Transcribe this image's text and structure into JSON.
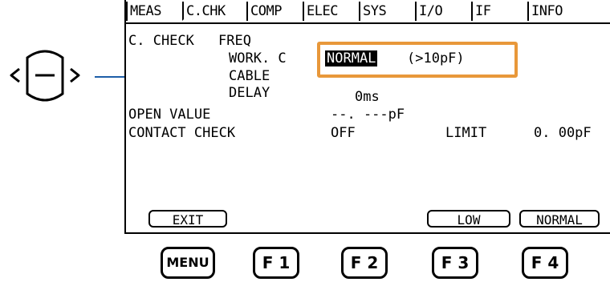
{
  "tabs": [
    {
      "label": "MEAS",
      "active": false
    },
    {
      "label": "C.CHK",
      "active": true
    },
    {
      "label": "COMP",
      "active": false
    },
    {
      "label": "ELEC",
      "active": false
    },
    {
      "label": "SYS",
      "active": false
    },
    {
      "label": "I/O",
      "active": false
    },
    {
      "label": "IF",
      "active": false
    },
    {
      "label": "INFO",
      "active": false
    }
  ],
  "settings": {
    "cchk_label": "C. CHECK",
    "freq_label": "FREQ",
    "freq_value": "",
    "work_c_label": "WORK. C",
    "work_c_value": "NORMAL",
    "work_c_suffix": "(>10pF)",
    "cable_label": "CABLE",
    "cable_value": "",
    "delay_label": "DELAY",
    "delay_value": "0ms",
    "open_value_label": "OPEN VALUE",
    "open_value": "--. ---pF",
    "contact_check_label": "CONTACT CHECK",
    "contact_check_value": "OFF",
    "limit_label": "LIMIT",
    "limit_value": "0. 00pF"
  },
  "function_keys": [
    "EXIT",
    "LOW",
    "NORMAL"
  ],
  "hardware_buttons": [
    "MENU",
    "F 1",
    "F 2",
    "F 3",
    "F 4"
  ],
  "colors": {
    "highlight": "#e8983a",
    "leader": "#1d5ea8"
  },
  "icons": {
    "dpad": "up-down-left-right-key-icon"
  }
}
